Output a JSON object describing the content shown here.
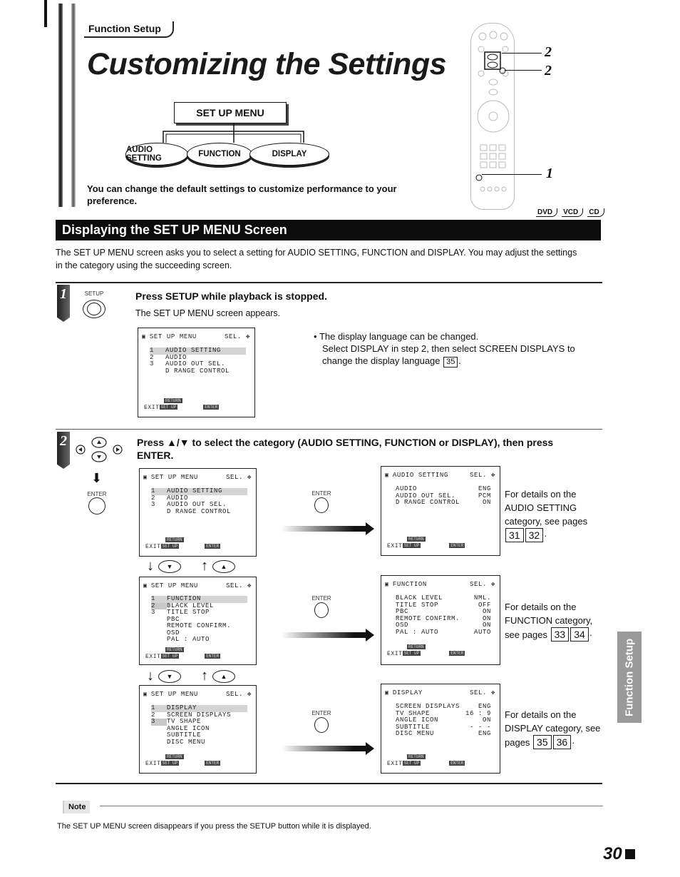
{
  "header": {
    "section_tab": "Function Setup",
    "title": "Customizing the Settings"
  },
  "diagram": {
    "root": "SET UP MENU",
    "branches": [
      "AUDIO SETTING",
      "FUNCTION",
      "DISPLAY"
    ]
  },
  "intro": "You can change the default settings to customize performance to your preference.",
  "remote_callouts": [
    "2",
    "2",
    "1"
  ],
  "disc_types": [
    "DVD",
    "VCD",
    "CD"
  ],
  "section": {
    "title": "Displaying the SET UP MENU Screen",
    "description": "The SET UP MENU screen asks you to select a setting for AUDIO SETTING, FUNCTION and DISPLAY. You may adjust the settings in the category using the succeeding screen."
  },
  "step1": {
    "number": "1",
    "button_label": "SETUP",
    "title": "Press SETUP while playback is stopped.",
    "subtitle": "The SET UP MENU screen appears.",
    "note_line1": "The display language can be changed.",
    "note_line2": "Select DISPLAY in step 2, then select SCREEN DISPLAYS to change the display language",
    "note_ref": "35"
  },
  "step2": {
    "number": "2",
    "button_label": "ENTER",
    "title": "Press ▲/▼ to select the category (AUDIO SETTING, FUNCTION or DISPLAY), then press ENTER.",
    "down_label": "▼",
    "up_label": "▲"
  },
  "osd_common": {
    "sel": "SEL. ✥",
    "return": "RETURN",
    "exit": "EXIT",
    "setup": "SET UP",
    "enter": "ENTER",
    "enter_label": "ENTER"
  },
  "screens": {
    "menu_audio": {
      "title": "SET UP MENU",
      "rows": [
        {
          "n": "1",
          "label": "AUDIO SETTING"
        },
        {
          "n": "2",
          "label": "AUDIO"
        },
        {
          "n": "3",
          "label": "AUDIO OUT SEL."
        },
        {
          "n": "",
          "label": "D RANGE CONTROL"
        }
      ]
    },
    "menu_function": {
      "title": "SET UP MENU",
      "rows": [
        {
          "n": "1",
          "label": "FUNCTION"
        },
        {
          "n": "2",
          "label": "BLACK LEVEL"
        },
        {
          "n": "3",
          "label": "TITLE STOP"
        },
        {
          "n": "",
          "label": "PBC"
        },
        {
          "n": "",
          "label": "REMOTE CONFIRM."
        },
        {
          "n": "",
          "label": "OSD"
        },
        {
          "n": "",
          "label": "PAL : AUTO"
        }
      ]
    },
    "menu_display": {
      "title": "SET UP MENU",
      "rows": [
        {
          "n": "1",
          "label": "DISPLAY"
        },
        {
          "n": "2",
          "label": "SCREEN DISPLAYS"
        },
        {
          "n": "3",
          "label": "TV SHAPE"
        },
        {
          "n": "",
          "label": "ANGLE ICON"
        },
        {
          "n": "",
          "label": "SUBTITLE"
        },
        {
          "n": "",
          "label": "DISC MENU"
        }
      ]
    },
    "audio_setting": {
      "title": "AUDIO SETTING",
      "rows": [
        {
          "label": "AUDIO",
          "value": "ENG"
        },
        {
          "label": "AUDIO OUT SEL.",
          "value": "PCM"
        },
        {
          "label": "D RANGE CONTROL",
          "value": "ON"
        }
      ]
    },
    "function": {
      "title": "FUNCTION",
      "rows": [
        {
          "label": "BLACK LEVEL",
          "value": "NML."
        },
        {
          "label": "TITLE STOP",
          "value": "OFF"
        },
        {
          "label": "PBC",
          "value": "ON"
        },
        {
          "label": "REMOTE CONFIRM.",
          "value": "ON"
        },
        {
          "label": "OSD",
          "value": "ON"
        },
        {
          "label": "PAL : AUTO",
          "value": "AUTO"
        }
      ]
    },
    "display": {
      "title": "DISPLAY",
      "rows": [
        {
          "label": "SCREEN DISPLAYS",
          "value": "ENG"
        },
        {
          "label": "TV SHAPE",
          "value": "16 : 9"
        },
        {
          "label": "ANGLE ICON",
          "value": "ON"
        },
        {
          "label": "SUBTITLE",
          "value": "- - -"
        },
        {
          "label": "DISC MENU",
          "value": "ENG"
        }
      ]
    }
  },
  "details": {
    "audio": {
      "text": "For details on the AUDIO SETTING category, see pages",
      "refs": [
        "31",
        "32"
      ]
    },
    "function": {
      "text": "For details on the FUNCTION category, see pages",
      "refs": [
        "33",
        "34"
      ]
    },
    "display": {
      "text": "For details on the DISPLAY category, see pages",
      "refs": [
        "35",
        "36"
      ]
    }
  },
  "side_tab": "Function Setup",
  "note": {
    "label": "Note",
    "text": "The SET UP MENU screen disappears if you press the SETUP button while it is displayed."
  },
  "page_number": "30"
}
